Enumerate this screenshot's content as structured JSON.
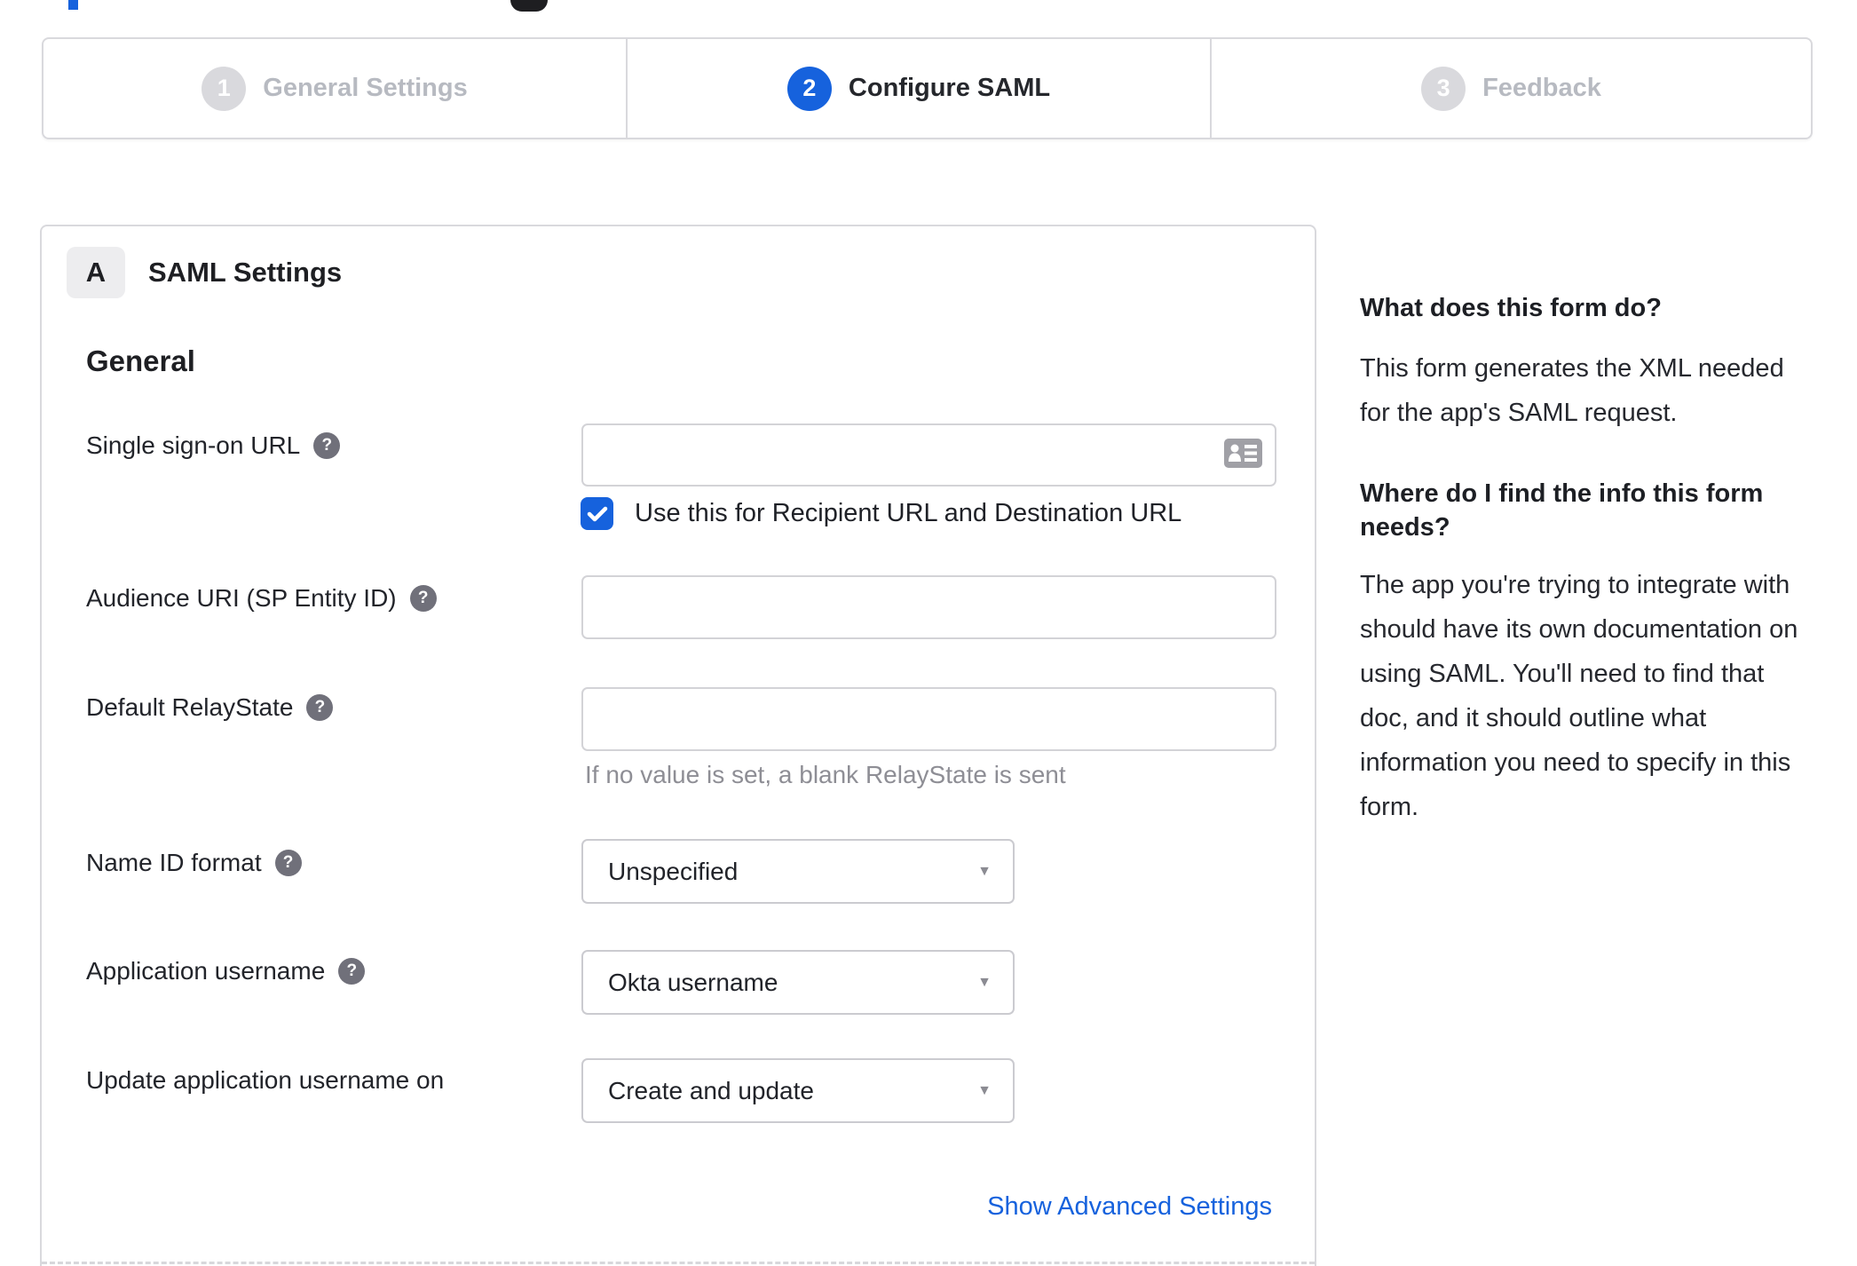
{
  "stepper": {
    "steps": [
      {
        "number": "1",
        "label": "General Settings"
      },
      {
        "number": "2",
        "label": "Configure SAML"
      },
      {
        "number": "3",
        "label": "Feedback"
      }
    ]
  },
  "form": {
    "section_badge": "A",
    "section_title": "SAML Settings",
    "group_title": "General",
    "sso": {
      "label": "Single sign-on URL",
      "value": "",
      "checkbox_label": "Use this for Recipient URL and Destination URL",
      "checkbox_checked": true
    },
    "audience": {
      "label": "Audience URI (SP Entity ID)",
      "value": ""
    },
    "relay": {
      "label": "Default RelayState",
      "value": "",
      "hint": "If no value is set, a blank RelayState is sent"
    },
    "nameid": {
      "label": "Name ID format",
      "value": "Unspecified"
    },
    "appuser": {
      "label": "Application username",
      "value": "Okta username"
    },
    "updateuser": {
      "label": "Update application username on",
      "value": "Create and update"
    },
    "advanced_link": "Show Advanced Settings"
  },
  "sidebar": {
    "q1": "What does this form do?",
    "a1_lines": [
      "This form generates the XML needed",
      "for the app's SAML request."
    ],
    "q2_lines": [
      "Where do I find the info this form",
      "needs?"
    ],
    "a2_lines": [
      "The app you're trying to integrate with",
      "should have its own documentation on",
      "using SAML. You'll need to find that",
      "doc, and it should outline what",
      "information you need to specify in this",
      "form."
    ]
  },
  "colors": {
    "accent": "#1662dd"
  }
}
